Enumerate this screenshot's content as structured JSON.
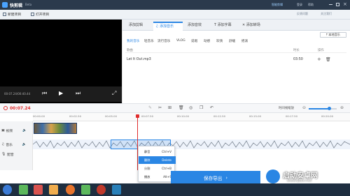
{
  "app": {
    "title": "快剪辑",
    "badge": "Beta"
  },
  "titlebar": {
    "right_items": [
      "智能剪辑",
      "登录",
      "帮助",
      "反馈问题",
      "关注我们"
    ]
  },
  "menubar": {
    "items": [
      "新建项目",
      "打开项目"
    ]
  },
  "preview": {
    "time": "00:07.24/00:40.44"
  },
  "tabs": [
    {
      "label": "添加剪辑",
      "active": false
    },
    {
      "label": "添加音乐",
      "active": true
    },
    {
      "label": "添加音效",
      "active": false
    },
    {
      "label": "添加字幕",
      "active": false
    },
    {
      "label": "添加转场",
      "active": false
    }
  ],
  "local_music_button": "本地音乐",
  "music_categories": [
    {
      "label": "我的音乐",
      "active": true
    },
    {
      "label": "轻音乐",
      "active": false
    },
    {
      "label": "流行音乐",
      "active": false
    },
    {
      "label": "VLOG",
      "active": false
    },
    {
      "label": "说唱",
      "active": false
    },
    {
      "label": "动感",
      "active": false
    },
    {
      "label": "欢快",
      "active": false
    },
    {
      "label": "舒缓",
      "active": false
    },
    {
      "label": "摇滚",
      "active": false
    }
  ],
  "list": {
    "headers": {
      "name": "歌曲",
      "duration": "时长",
      "actions": "操作"
    },
    "rows": [
      {
        "name": "Let It Out.mp3",
        "duration": "03:50"
      }
    ]
  },
  "timeline": {
    "current_time": "00:07.24",
    "zoom_label": "时间线缩放",
    "zoom_value": 0.75,
    "ruler": [
      "00:00.00",
      "00:02.50",
      "00:05.00",
      "00:07.50",
      "00:10.00",
      "00:12.50",
      "00:15.00",
      "00:17.50",
      "00:20.00"
    ],
    "tracks": [
      {
        "label": "视频",
        "icon": "film-icon"
      },
      {
        "label": "音乐",
        "icon": "music-note-icon"
      },
      {
        "label": "配音",
        "icon": "mic-icon"
      }
    ]
  },
  "context_menu": [
    {
      "label": "静音",
      "shortcut": "Ctrl+V",
      "highlight": false
    },
    {
      "label": "删除",
      "shortcut": "Delete",
      "highlight": true
    },
    {
      "label": "分割",
      "shortcut": "Ctrl+B",
      "highlight": false
    },
    {
      "label": "播放",
      "shortcut": "Alt+S",
      "highlight": false
    }
  ],
  "export_button": "保存导出",
  "watermark": {
    "title": "启动安卓网",
    "url": "www.qdzx.net"
  },
  "colors": {
    "accent": "#2a86e4",
    "titlebar": "#2b3a4c",
    "playhead": "#e02d2d"
  }
}
